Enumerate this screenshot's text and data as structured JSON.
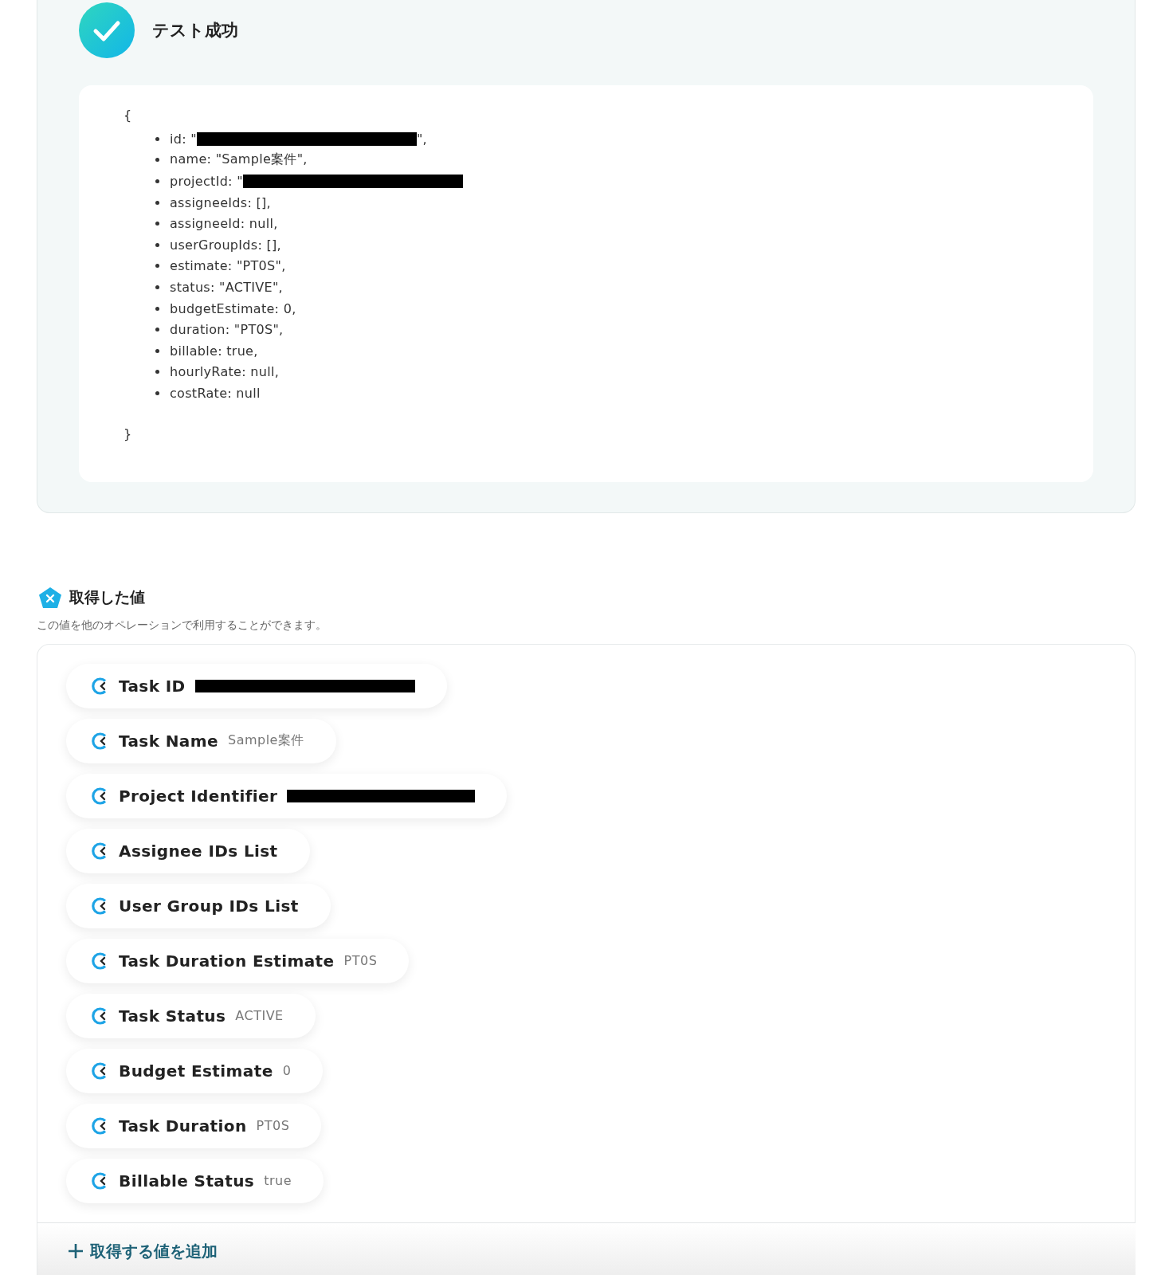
{
  "test_result": {
    "title": "テスト成功",
    "success": true,
    "open_brace": "{",
    "close_brace": "}",
    "lines": [
      {
        "before": "id: \"",
        "redacted": true,
        "after": "\","
      },
      {
        "before": "name: \"Sample案件\",",
        "redacted": false
      },
      {
        "before": "projectId: \"",
        "redacted": true
      },
      {
        "before": "assigneeIds: [],",
        "redacted": false
      },
      {
        "before": "assigneeId: null,",
        "redacted": false
      },
      {
        "before": "userGroupIds: [],",
        "redacted": false
      },
      {
        "before": "estimate: \"PT0S\",",
        "redacted": false
      },
      {
        "before": "status: \"ACTIVE\",",
        "redacted": false
      },
      {
        "before": "budgetEstimate: 0,",
        "redacted": false
      },
      {
        "before": "duration: \"PT0S\",",
        "redacted": false
      },
      {
        "before": "billable: true,",
        "redacted": false
      },
      {
        "before": "hourlyRate: null,",
        "redacted": false
      },
      {
        "before": "costRate: null",
        "redacted": false
      }
    ]
  },
  "values_section": {
    "title": "取得した値",
    "description": "この値を他のオペレーションで利用することができます。",
    "items": [
      {
        "label": "Task ID",
        "redacted": true
      },
      {
        "label": "Task Name",
        "value": "Sample案件",
        "redacted": false
      },
      {
        "label": "Project Identifier",
        "redacted": true
      },
      {
        "label": "Assignee IDs List",
        "redacted": false
      },
      {
        "label": "User Group IDs List",
        "redacted": false
      },
      {
        "label": "Task Duration Estimate",
        "value": "PT0S",
        "redacted": false
      },
      {
        "label": "Task Status",
        "value": "ACTIVE",
        "redacted": false
      },
      {
        "label": "Budget Estimate",
        "value": "0",
        "redacted": false
      },
      {
        "label": "Task Duration",
        "value": "PT0S",
        "redacted": false
      },
      {
        "label": "Billable Status",
        "value": "true",
        "redacted": false
      }
    ],
    "add_button": {
      "label": "取得する値を追加"
    }
  }
}
